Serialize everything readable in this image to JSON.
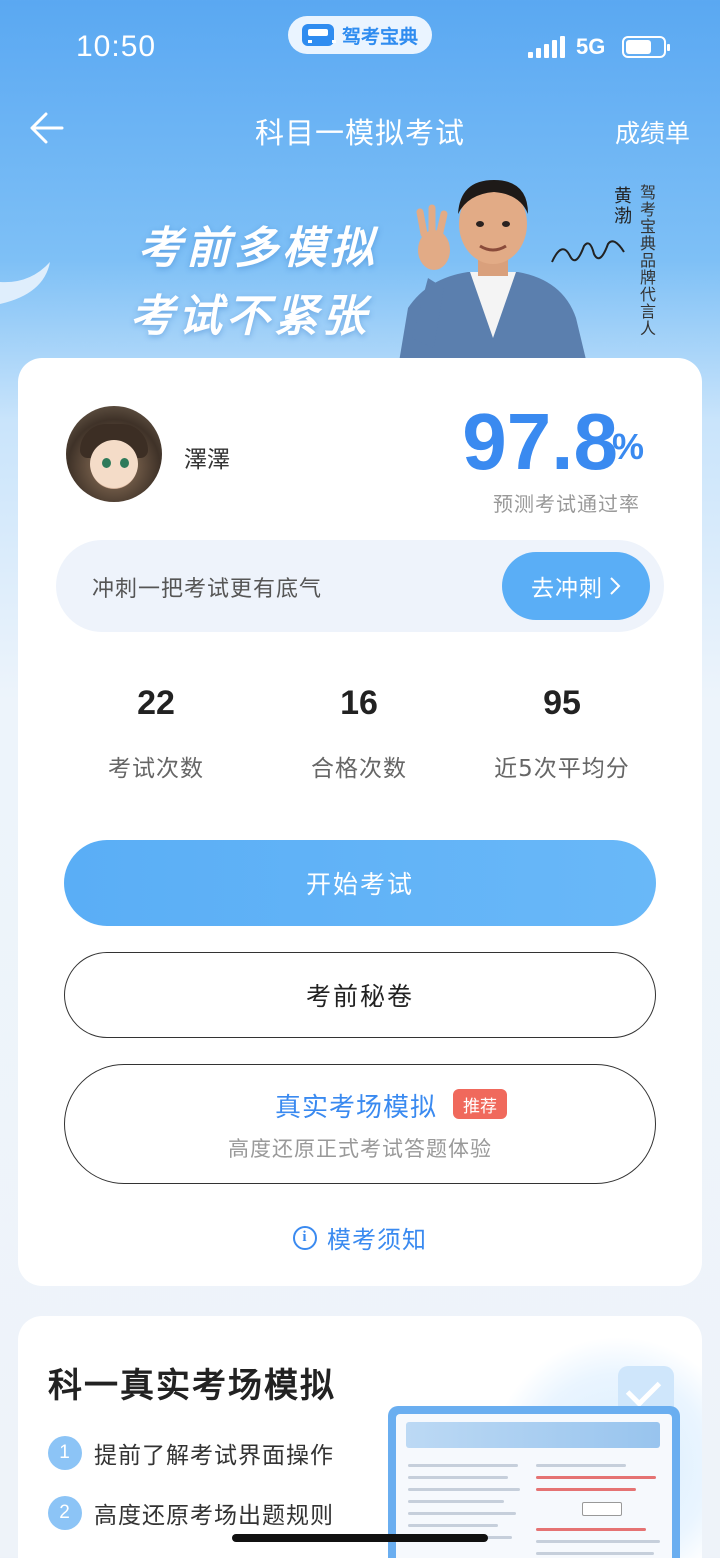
{
  "status_bar": {
    "time": "10:50",
    "app_name": "驾考宝典",
    "network": "5G",
    "battery_level": 0.7
  },
  "nav": {
    "title": "科目一模拟考试",
    "right_link": "成绩单"
  },
  "banner": {
    "slogan_line1": "考前多模拟",
    "slogan_line2": "考试不紧张",
    "spokesperson_name": "黄渤",
    "spokesperson_title": "驾考宝典品牌代言人"
  },
  "profile": {
    "username": "澤澤",
    "pass_rate_value": "97.8",
    "pass_rate_unit": "%",
    "pass_rate_label": "预测考试通过率"
  },
  "sprint": {
    "text": "冲刺一把考试更有底气",
    "button": "去冲刺"
  },
  "stats": [
    {
      "value": "22",
      "label": "考试次数"
    },
    {
      "value": "16",
      "label": "合格次数"
    },
    {
      "value": "95",
      "label": "近5次平均分"
    }
  ],
  "actions": {
    "start": "开始考试",
    "secret": "考前秘卷",
    "real_title": "真实考场模拟",
    "real_badge": "推荐",
    "real_sub": "高度还原正式考试答题体验",
    "notice": "模考须知"
  },
  "real_section": {
    "title": "科一真实考场模拟",
    "features": [
      {
        "num": "1",
        "text": "提前了解考试界面操作"
      },
      {
        "num": "2",
        "text": "高度还原考场出题规则"
      }
    ]
  },
  "colors": {
    "accent": "#3a8af0",
    "button": "#5aaef6",
    "badge": "#f0695c"
  }
}
